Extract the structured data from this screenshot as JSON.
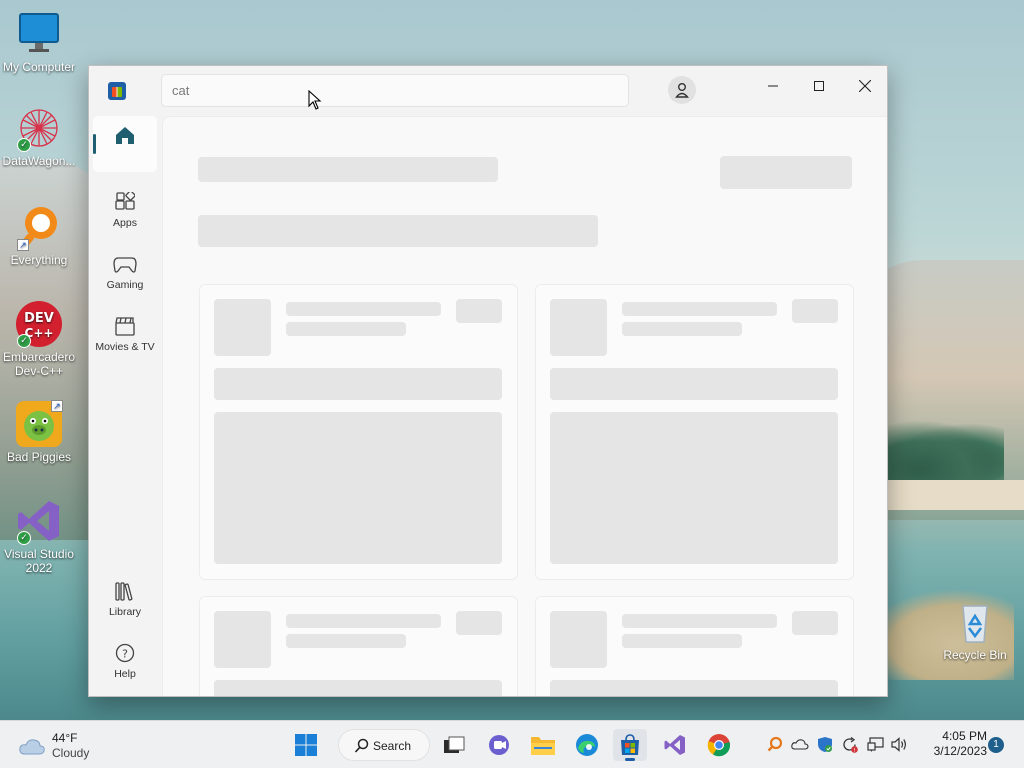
{
  "desktop": {
    "icons": [
      {
        "label": "My Computer"
      },
      {
        "label": "DataWagon..."
      },
      {
        "label": "Everything"
      },
      {
        "label": "Embarcadero Dev-C++"
      },
      {
        "label": "Bad Piggies"
      },
      {
        "label": "Visual Studio 2022"
      },
      {
        "label": "Recycle Bin"
      }
    ]
  },
  "store": {
    "search": {
      "value": "cat"
    },
    "nav": [
      {
        "label": ""
      },
      {
        "label": "Apps"
      },
      {
        "label": "Gaming"
      },
      {
        "label": "Movies & TV"
      },
      {
        "label": "Library"
      },
      {
        "label": "Help"
      }
    ]
  },
  "taskbar": {
    "weather": {
      "temp": "44°F",
      "condition": "Cloudy"
    },
    "search_label": "Search",
    "clock": {
      "time": "4:05 PM",
      "date": "3/12/2023"
    },
    "notification_count": "1"
  }
}
